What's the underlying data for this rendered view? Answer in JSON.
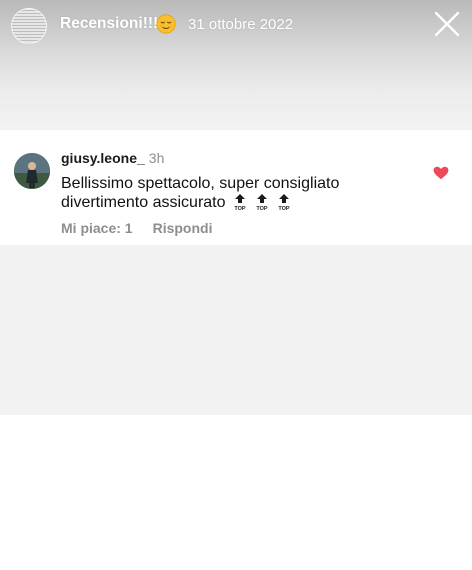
{
  "story": {
    "title": "Recensioni!!!",
    "date": "31 ottobre 2022",
    "title_emoji": "relieved-face-icon"
  },
  "comment": {
    "username": "giusy.leone_",
    "time": "3h",
    "text": "Bellissimo spettacolo, super consigliato divertimento assicurato",
    "badges": [
      "top-arrow-icon",
      "top-arrow-icon",
      "top-arrow-icon"
    ],
    "likes_label": "Mi piace: 1",
    "reply_label": "Rispondi",
    "liked": true
  },
  "colors": {
    "heart": "#ed4956",
    "muted_text": "#8e8e8e",
    "primary_text": "#111111"
  }
}
